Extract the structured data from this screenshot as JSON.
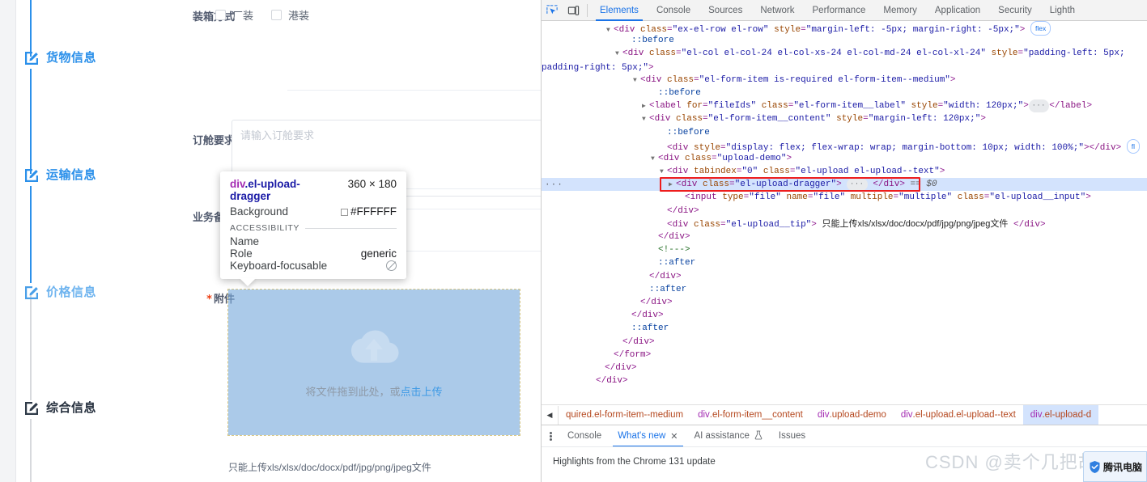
{
  "page": {
    "steps": [
      {
        "label": "货物信息",
        "state": "active"
      },
      {
        "label": "运输信息",
        "state": "active"
      },
      {
        "label": "价格信息",
        "state": "muted"
      },
      {
        "label": "综合信息",
        "state": "inactive"
      }
    ],
    "fields": {
      "packing_label": "装箱方式",
      "packing_options": [
        "厂装",
        "港装"
      ],
      "booking_label": "订舱要求",
      "booking_placeholder": "请输入订舱要求",
      "remark_label": "业务备注",
      "attachment_label": "附件",
      "attachment_required_mark": "*"
    },
    "upload": {
      "drag_text": "将文件拖到此处，或",
      "drag_link": "点击上传",
      "tip": "只能上传xls/xlsx/doc/docx/pdf/jpg/png/jpeg文件",
      "icon": "cloud-upload-icon"
    }
  },
  "inspect_tooltip": {
    "tag": "div",
    "classes": ".el-upload-dragger",
    "dimensions": "360 × 180",
    "background_label": "Background",
    "background_value": "#FFFFFF",
    "section_title": "ACCESSIBILITY",
    "name_label": "Name",
    "name_value": "",
    "role_label": "Role",
    "role_value": "generic",
    "focusable_label": "Keyboard-focusable",
    "focusable_icon": "not-allowed-icon"
  },
  "devtools": {
    "toolbar_icons": [
      "inspect-element-icon",
      "device-toolbar-icon"
    ],
    "tabs": [
      {
        "label": "Elements",
        "selected": true
      },
      {
        "label": "Console",
        "selected": false
      },
      {
        "label": "Sources",
        "selected": false
      },
      {
        "label": "Network",
        "selected": false
      },
      {
        "label": "Performance",
        "selected": false
      },
      {
        "label": "Memory",
        "selected": false
      },
      {
        "label": "Application",
        "selected": false
      },
      {
        "label": "Security",
        "selected": false
      },
      {
        "label": "Lighth",
        "selected": false
      }
    ],
    "dom_lines": [
      {
        "indent": 6,
        "tw": "open",
        "html": "<span class='p'>&lt;</span><span class='tag'>div</span> <span class='at'>class</span><span class='p'>=</span><span class='av'>\"ex-el-row el-row\"</span> <span class='at'>style</span><span class='p'>=</span><span class='av'>\"margin-left: -5px; margin-right: -5px;\"</span><span class='p'>&gt;</span> <span class='badge'>flex</span>"
      },
      {
        "indent": 8,
        "tw": "none",
        "html": "<span class='pe'>::before</span>"
      },
      {
        "indent": 7,
        "tw": "open",
        "wrap": true,
        "html": "<span class='p'>&lt;</span><span class='tag'>div</span> <span class='at'>class</span><span class='p'>=</span><span class='av'>\"el-col el-col-24 el-col-xs-24 el-col-md-24 el-col-xl-24\"</span> <span class='at'>style</span><span class='p'>=</span><span class='av'>\"padding-left: 5px; padding-right: 5px;\"</span><span class='p'>&gt;</span>"
      },
      {
        "indent": 9,
        "tw": "open",
        "html": "<span class='p'>&lt;</span><span class='tag'>div</span> <span class='at'>class</span><span class='p'>=</span><span class='av'>\"el-form-item is-required el-form-item--medium\"</span><span class='p'>&gt;</span>"
      },
      {
        "indent": 11,
        "tw": "none",
        "html": "<span class='pe'>::before</span>"
      },
      {
        "indent": 10,
        "tw": "closed",
        "html": "<span class='p'>&lt;</span><span class='tag'>label</span> <span class='at'>for</span><span class='p'>=</span><span class='av'>\"fileIds\"</span> <span class='at'>class</span><span class='p'>=</span><span class='av'>\"el-form-item__label\"</span> <span class='at'>style</span><span class='p'>=</span><span class='av'>\"width: 120px;\"</span><span class='p'>&gt;</span><span class='ellips'>···</span><span class='p'>&lt;/</span><span class='tag'>label</span><span class='p'>&gt;</span>"
      },
      {
        "indent": 10,
        "tw": "open",
        "html": "<span class='p'>&lt;</span><span class='tag'>div</span> <span class='at'>class</span><span class='p'>=</span><span class='av'>\"el-form-item__content\"</span> <span class='at'>style</span><span class='p'>=</span><span class='av'>\"margin-left: 120px;\"</span><span class='p'>&gt;</span>"
      },
      {
        "indent": 12,
        "tw": "none",
        "html": "<span class='pe'>::before</span>"
      },
      {
        "indent": 12,
        "tw": "none",
        "html": "<span class='p'>&lt;</span><span class='tag'>div</span> <span class='at'>style</span><span class='p'>=</span><span class='av'>\"display: flex; flex-wrap: wrap; margin-bottom: 10px; width: 100%;\"</span><span class='p'>&gt;&lt;/</span><span class='tag'>div</span><span class='p'>&gt;</span> <span class='badge'>fl</span>"
      },
      {
        "indent": 11,
        "tw": "open",
        "html": "<span class='p'>&lt;</span><span class='tag'>div</span> <span class='at'>class</span><span class='p'>=</span><span class='av'>\"upload-demo\"</span><span class='p'>&gt;</span>"
      },
      {
        "indent": 12,
        "tw": "open",
        "html": "<span class='p'>&lt;</span><span class='tag'>div</span> <span class='at'>tabindex</span><span class='p'>=</span><span class='av'>\"0\"</span> <span class='at'>class</span><span class='p'>=</span><span class='av'>\"el-upload el-upload--text\"</span><span class='p'>&gt;</span>"
      },
      {
        "indent": 13,
        "tw": "closed",
        "selected": true,
        "html": "<span class='p'>&lt;</span><span class='tag'>div</span> <span class='at'>class</span><span class='p'>=</span><span class='av'>\"el-upload-dragger\"</span><span class='p'>&gt;</span> <span class='ellips'>···</span> <span class='p'>&lt;/</span><span class='tag'>div</span><span class='p'>&gt;</span> <span class='eq0'>== $0</span>"
      },
      {
        "indent": 14,
        "tw": "none",
        "html": "<span class='p'>&lt;</span><span class='tag'>input</span> <span class='at'>type</span><span class='p'>=</span><span class='av'>\"file\"</span> <span class='at'>name</span><span class='p'>=</span><span class='av'>\"file\"</span> <span class='at'>multiple</span><span class='p'>=</span><span class='av'>\"multiple\"</span> <span class='at'>class</span><span class='p'>=</span><span class='av'>\"el-upload__input\"</span><span class='p'>&gt;</span>"
      },
      {
        "indent": 12,
        "tw": "none",
        "html": "<span class='p'>&lt;/</span><span class='tag'>div</span><span class='p'>&gt;</span>"
      },
      {
        "indent": 12,
        "tw": "none",
        "html": "<span class='p'>&lt;</span><span class='tag'>div</span> <span class='at'>class</span><span class='p'>=</span><span class='av'>\"el-upload__tip\"</span><span class='p'>&gt;</span> <span class='txt'>只能上传xls/xlsx/doc/docx/pdf/jpg/png/jpeg文件</span> <span class='p'>&lt;/</span><span class='tag'>div</span><span class='p'>&gt;</span>"
      },
      {
        "indent": 11,
        "tw": "none",
        "html": "<span class='p'>&lt;/</span><span class='tag'>div</span><span class='p'>&gt;</span>"
      },
      {
        "indent": 11,
        "tw": "none",
        "html": "<span class='cm'>&lt;!---&gt;</span>"
      },
      {
        "indent": 11,
        "tw": "none",
        "html": "<span class='pe'>::after</span>"
      },
      {
        "indent": 10,
        "tw": "none",
        "html": "<span class='p'>&lt;/</span><span class='tag'>div</span><span class='p'>&gt;</span>"
      },
      {
        "indent": 10,
        "tw": "none",
        "html": "<span class='pe'>::after</span>"
      },
      {
        "indent": 9,
        "tw": "none",
        "html": "<span class='p'>&lt;/</span><span class='tag'>div</span><span class='p'>&gt;</span>"
      },
      {
        "indent": 8,
        "tw": "none",
        "html": "<span class='p'>&lt;/</span><span class='tag'>div</span><span class='p'>&gt;</span>"
      },
      {
        "indent": 8,
        "tw": "none",
        "html": "<span class='pe'>::after</span>"
      },
      {
        "indent": 7,
        "tw": "none",
        "html": "<span class='p'>&lt;/</span><span class='tag'>div</span><span class='p'>&gt;</span>"
      },
      {
        "indent": 6,
        "tw": "none",
        "html": "<span class='p'>&lt;/</span><span class='tag'>form</span><span class='p'>&gt;</span>"
      },
      {
        "indent": 5,
        "tw": "none",
        "html": "<span class='p'>&lt;/</span><span class='tag'>div</span><span class='p'>&gt;</span>"
      },
      {
        "indent": 4,
        "tw": "none",
        "html": "<span class='p'>&lt;/</span><span class='tag'>div</span><span class='p'>&gt;</span>"
      }
    ],
    "breadcrumbs": [
      {
        "text": "quired.el-form-item--medium",
        "selected": false,
        "truncated": true
      },
      {
        "text": "div.el-form-item__content",
        "selected": false
      },
      {
        "text": "div.upload-demo",
        "selected": false
      },
      {
        "text": "div.el-upload.el-upload--text",
        "selected": false
      },
      {
        "text": "div.el-upload-d",
        "selected": true,
        "truncated": true
      }
    ],
    "drawer_tabs": [
      {
        "label": "Console",
        "selected": false,
        "closable": false
      },
      {
        "label": "What's new",
        "selected": true,
        "closable": true
      },
      {
        "label": "AI assistance",
        "selected": false,
        "closable": false,
        "icon": "flask-icon"
      },
      {
        "label": "Issues",
        "selected": false,
        "closable": false
      }
    ],
    "drawer_content": {
      "title": "Highlights from the Chrome 131 update"
    }
  },
  "overlays": {
    "watermark": "CSDN @卖个几把胡药",
    "tencent_badge": "腾讯电脑"
  },
  "colors": {
    "accent": "#1a73e8",
    "step_active": "#2b90ea",
    "highlight": "#d3e3fd",
    "selection_box": "#ee1d1d",
    "dragger_overlay": "#78aadc"
  }
}
